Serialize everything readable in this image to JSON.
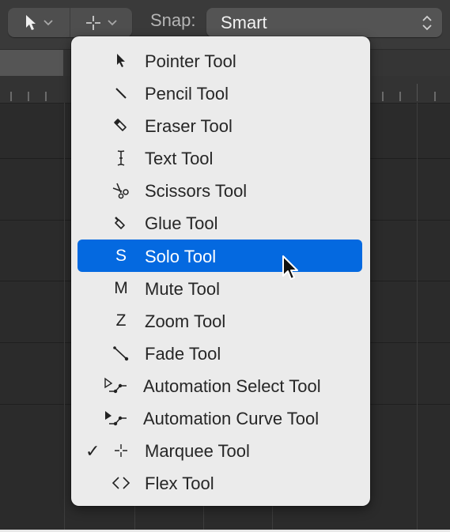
{
  "toolbar": {
    "left_tool": {
      "icon": "pointer-icon",
      "menu": "chevron-down"
    },
    "right_tool": {
      "icon": "marquee-crosshair-icon",
      "menu": "chevron-down"
    },
    "snap_label": "Snap:",
    "snap_value": "Smart"
  },
  "colors": {
    "highlight": "#0469e0",
    "menu_bg": "#ebebeb",
    "background": "#2b2b2b"
  },
  "menu": {
    "items": [
      {
        "label": "Pointer Tool",
        "icon": "pointer-icon",
        "checked": false,
        "highlighted": false
      },
      {
        "label": "Pencil Tool",
        "icon": "pencil-icon",
        "checked": false,
        "highlighted": false
      },
      {
        "label": "Eraser Tool",
        "icon": "eraser-icon",
        "checked": false,
        "highlighted": false
      },
      {
        "label": "Text Tool",
        "icon": "text-cursor-icon",
        "checked": false,
        "highlighted": false
      },
      {
        "label": "Scissors Tool",
        "icon": "scissors-icon",
        "checked": false,
        "highlighted": false
      },
      {
        "label": "Glue Tool",
        "icon": "glue-icon",
        "checked": false,
        "highlighted": false
      },
      {
        "label": "Solo Tool",
        "icon": "S",
        "checked": false,
        "highlighted": true
      },
      {
        "label": "Mute Tool",
        "icon": "M",
        "checked": false,
        "highlighted": false
      },
      {
        "label": "Zoom Tool",
        "icon": "Z",
        "checked": false,
        "highlighted": false
      },
      {
        "label": "Fade Tool",
        "icon": "fade-icon",
        "checked": false,
        "highlighted": false
      },
      {
        "label": "Automation Select Tool",
        "icon": "automation-select-icon",
        "checked": false,
        "highlighted": false
      },
      {
        "label": "Automation Curve Tool",
        "icon": "automation-curve-icon",
        "checked": false,
        "highlighted": false
      },
      {
        "label": "Marquee Tool",
        "icon": "marquee-icon",
        "checked": true,
        "highlighted": false
      },
      {
        "label": "Flex Tool",
        "icon": "flex-icon",
        "checked": false,
        "highlighted": false
      }
    ],
    "check_glyph": "✓",
    "letters": {
      "solo": "S",
      "mute": "M",
      "zoom": "Z"
    },
    "flex_glyph": "<>"
  }
}
